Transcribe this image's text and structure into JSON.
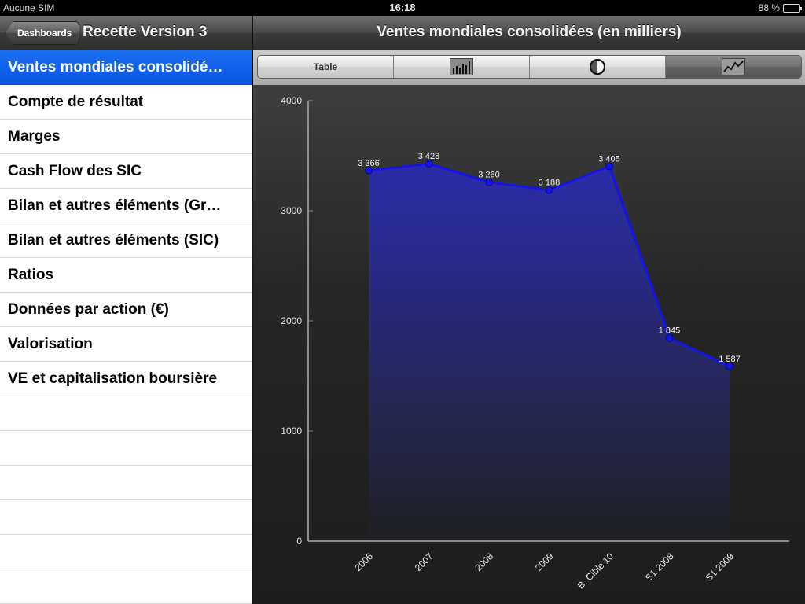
{
  "status_bar": {
    "carrier": "Aucune SIM",
    "time": "16:18",
    "battery": "88 %",
    "battery_level": 0.88
  },
  "left_nav": {
    "back_label": "Dashboards",
    "title": "Recette Version 3"
  },
  "list": {
    "items": [
      {
        "label": "Ventes mondiales consolidé…",
        "selected": true
      },
      {
        "label": "Compte de résultat"
      },
      {
        "label": "Marges"
      },
      {
        "label": "Cash Flow des SIC"
      },
      {
        "label": "Bilan et autres éléments (Gr…"
      },
      {
        "label": "Bilan et autres éléments (SIC)"
      },
      {
        "label": "Ratios"
      },
      {
        "label": "Données par action (€)"
      },
      {
        "label": "Valorisation"
      },
      {
        "label": "VE et capitalisation boursière"
      },
      {
        "label": ""
      },
      {
        "label": ""
      },
      {
        "label": ""
      },
      {
        "label": ""
      },
      {
        "label": ""
      },
      {
        "label": ""
      }
    ]
  },
  "right_nav": {
    "title": "Ventes mondiales consolidées (en milliers)"
  },
  "segments": [
    {
      "label": "Table",
      "icon": ""
    },
    {
      "label": "",
      "icon": "bar-chart-icon"
    },
    {
      "label": "",
      "icon": "pie-chart-icon"
    },
    {
      "label": "",
      "icon": "line-chart-icon",
      "active": true
    }
  ],
  "chart_data": {
    "type": "area",
    "categories": [
      "2006",
      "2007",
      "2008",
      "2009",
      "B. Cible 10",
      "S1 2008",
      "S1 2009"
    ],
    "values": [
      3366,
      3428,
      3260,
      3188,
      3405,
      1845,
      1587
    ],
    "value_labels": [
      "3 366",
      "3 428",
      "3 260",
      "3 188",
      "3 405",
      "1 845",
      "1 587"
    ],
    "ylim": [
      0,
      4000
    ],
    "yticks": [
      0,
      1000,
      2000,
      3000,
      4000
    ],
    "line_color": "#1414e6",
    "fill_color": "#2a2ab0"
  }
}
